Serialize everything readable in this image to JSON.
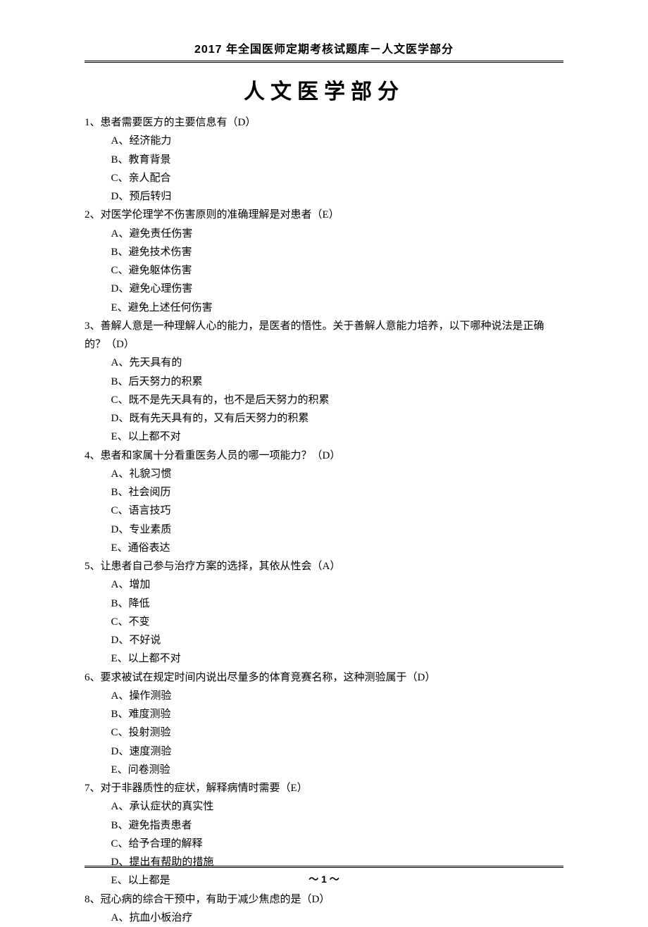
{
  "header": "2017 年全国医师定期考核试题库－人文医学部分",
  "title": "人文医学部分",
  "questions": [
    {
      "num": "1、",
      "text": "患者需要医方的主要信息有（D）",
      "options": [
        "A、经济能力",
        "B、教育背景",
        "C、亲人配合",
        "D、预后转归"
      ]
    },
    {
      "num": "2、",
      "text": "对医学伦理学不伤害原则的准确理解是对患者（E）",
      "options": [
        "A、避免责任伤害",
        "B、避免技术伤害",
        "C、避免躯体伤害",
        "D、避免心理伤害",
        "E、避免上述任何伤害"
      ]
    },
    {
      "num": "3、",
      "text": "善解人意是一种理解人心的能力，是医者的悟性。关于善解人意能力培养，以下哪种说法是正确的？（D）",
      "options": [
        "A、先天具有的",
        "B、后天努力的积累",
        "C、既不是先天具有的，也不是后天努力的积累",
        "D、既有先天具有的，又有后天努力的积累",
        "E、以上都不对"
      ]
    },
    {
      "num": "4、",
      "text": "患者和家属十分看重医务人员的哪一项能力？（D）",
      "options": [
        "A、礼貌习惯",
        "B、社会阅历",
        "C、语言技巧",
        "D、专业素质",
        "E、通俗表达"
      ]
    },
    {
      "num": "5、",
      "text": "让患者自己参与治疗方案的选择，其依从性会（A）",
      "options": [
        "A、增加",
        "B、降低",
        "C、不变",
        "D、不好说",
        "E、以上都不对"
      ]
    },
    {
      "num": "6、",
      "text": "要求被试在规定时间内说出尽量多的体育竞赛名称，这种测验属于（D）",
      "options": [
        "A、操作测验",
        "B、难度测验",
        "C、投射测验",
        "D、速度测验",
        "E、问卷测验"
      ]
    },
    {
      "num": "7、",
      "text": "对于非器质性的症状，解释病情时需要（E）",
      "options": [
        "A、承认症状的真实性",
        "B、避免指责患者",
        "C、给予合理的解释",
        "D、提出有帮助的措施",
        "E、以上都是"
      ]
    },
    {
      "num": "8、",
      "text": "冠心病的综合干预中，有助于减少焦虑的是（D）",
      "options": [
        "A、抗血小板治疗"
      ]
    }
  ],
  "pageNum": "～ 1 ～"
}
